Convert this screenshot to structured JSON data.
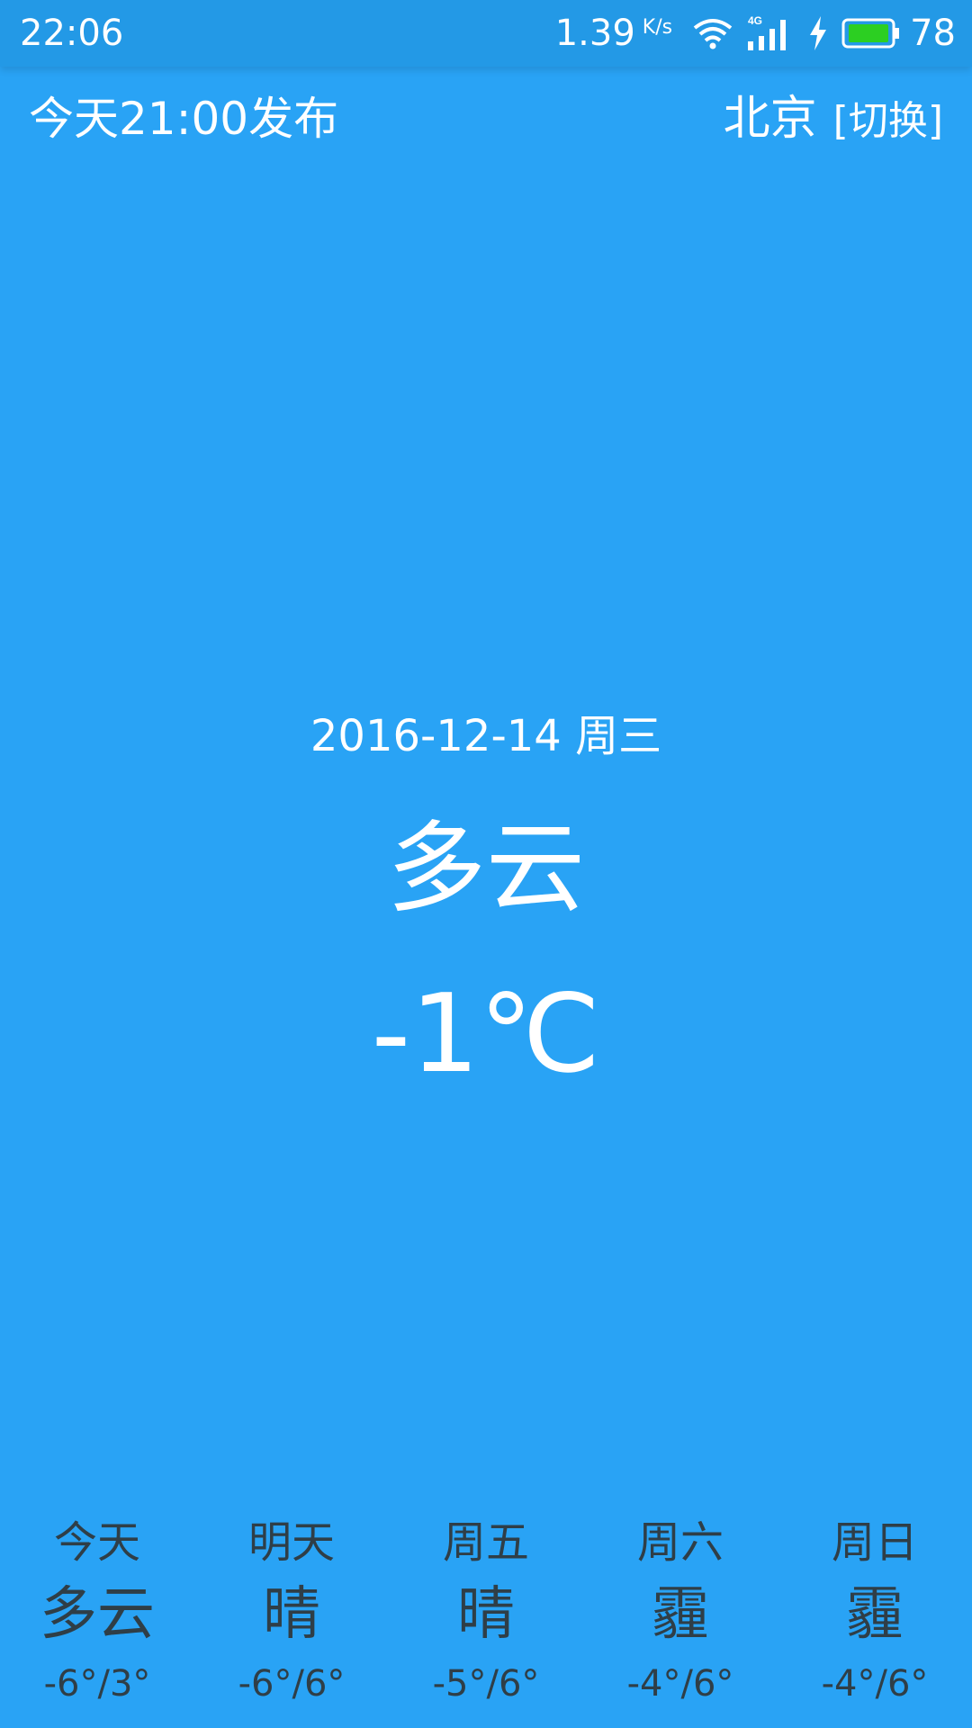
{
  "status_bar": {
    "time": "22:06",
    "net_speed": "1.39",
    "net_speed_unit": "K/s",
    "battery_level": "78",
    "battery_color": "#2ccf22",
    "icons": [
      "wifi-icon",
      "signal-4g-icon",
      "charging-icon",
      "battery-icon"
    ]
  },
  "header": {
    "publish_time": "今天21:00发布",
    "city": "北京",
    "switch_label": "[切换]"
  },
  "current": {
    "date": "2016-12-14  周三",
    "weather": "多云",
    "temperature": "-1℃"
  },
  "forecast": [
    {
      "day": "今天",
      "weather": "多云",
      "temp": "-6°/3°"
    },
    {
      "day": "明天",
      "weather": "晴",
      "temp": "-6°/6°"
    },
    {
      "day": "周五",
      "weather": "晴",
      "temp": "-5°/6°"
    },
    {
      "day": "周六",
      "weather": "霾",
      "temp": "-4°/6°"
    },
    {
      "day": "周日",
      "weather": "霾",
      "temp": "-4°/6°"
    }
  ],
  "colors": {
    "background": "#29a3f5",
    "status_bar": "#2399e6",
    "forecast_text": "#2f3e47"
  }
}
